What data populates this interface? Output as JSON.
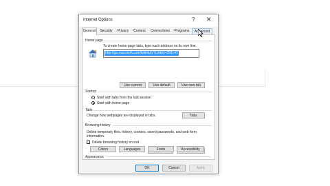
{
  "dialog": {
    "title": "Internet Options",
    "help_glyph": "?",
    "close_glyph": "✕"
  },
  "tabs": [
    {
      "label": "General",
      "state": "active"
    },
    {
      "label": "Security"
    },
    {
      "label": "Privacy"
    },
    {
      "label": "Content"
    },
    {
      "label": "Connections"
    },
    {
      "label": "Programs"
    },
    {
      "label": "Advanced",
      "state": "hover"
    }
  ],
  "home_page": {
    "group_label": "Home page",
    "instruction": "To create home page tabs, type each address on its own line.",
    "url_value": "http://go.microsoft.com/fwlink/p/?LinkId=255141",
    "icon": "house-icon",
    "buttons": [
      "Use current",
      "Use default",
      "Use new tab"
    ]
  },
  "startup": {
    "group_label": "Startup",
    "options": [
      {
        "label": "Start with tabs from the last session",
        "selected": false
      },
      {
        "label": "Start with home page",
        "selected": true
      }
    ]
  },
  "tabs_group": {
    "group_label": "Tabs",
    "description": "Change how webpages are displayed in tabs.",
    "button": "Tabs"
  },
  "browsing_history": {
    "group_label": "Browsing history",
    "description": "Delete temporary files, history, cookies, saved passwords, and web form information.",
    "checkbox_label": "Delete browsing history on exit",
    "checkbox_checked": false,
    "buttons": [
      "Delete...",
      "Settings"
    ]
  },
  "appearance": {
    "group_label": "Appearance",
    "buttons": [
      "Colors",
      "Languages",
      "Fonts",
      "Accessibility"
    ]
  },
  "footer": {
    "ok": "OK",
    "cancel": "Cancel",
    "apply": "Apply"
  },
  "colors": {
    "selection": "#3399ff",
    "ok_border": "#0078d7",
    "hover_tab": "#e3eef9"
  }
}
